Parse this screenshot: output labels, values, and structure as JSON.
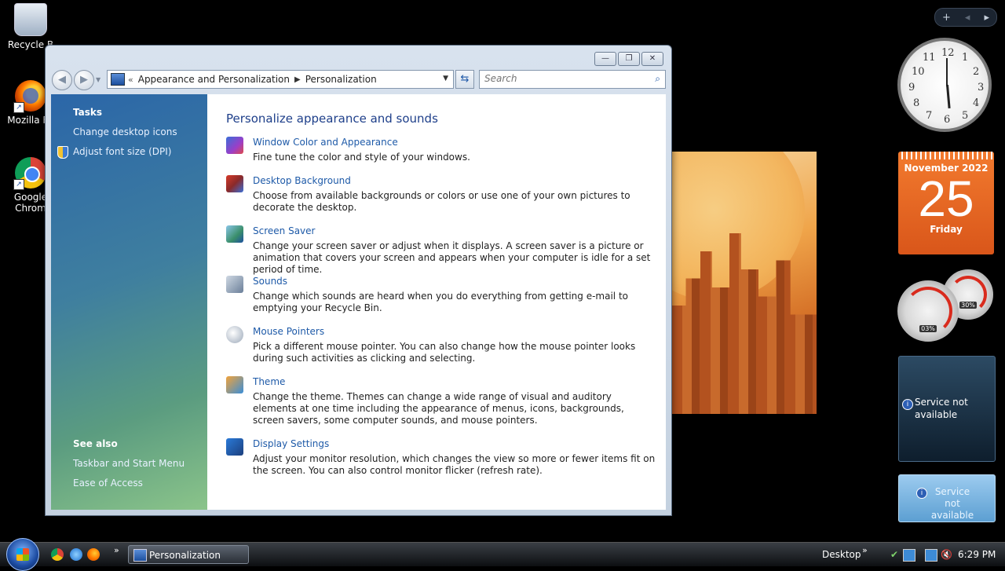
{
  "desktop_icons": [
    {
      "label": "Recycle B",
      "icon": "recycle-bin-icon"
    },
    {
      "label": "Mozilla Fir",
      "icon": "firefox-icon"
    },
    {
      "label": "Google Chrom",
      "icon": "chrome-icon"
    }
  ],
  "window": {
    "address": {
      "crumb1": "Appearance and Personalization",
      "crumb2": "Personalization"
    },
    "search_placeholder": "Search",
    "sidebar": {
      "tasks_heading": "Tasks",
      "tasks": [
        "Change desktop icons",
        "Adjust font size (DPI)"
      ],
      "see_also_heading": "See also",
      "see_also": [
        "Taskbar and Start Menu",
        "Ease of Access"
      ]
    },
    "title": "Personalize appearance and sounds",
    "items": [
      {
        "link": "Window Color and Appearance",
        "desc": "Fine tune the color and style of your windows.",
        "icon": "window-color-icon"
      },
      {
        "link": "Desktop Background",
        "desc": "Choose from available backgrounds or colors or use one of your own pictures to decorate the desktop.",
        "icon": "desktop-background-icon"
      },
      {
        "link": "Screen Saver",
        "desc": "Change your screen saver or adjust when it displays. A screen saver is a picture or animation that covers your screen and appears when your computer is idle for a set period of time.",
        "icon": "screen-saver-icon"
      },
      {
        "link": "Sounds",
        "desc": "Change which sounds are heard when you do everything from getting e-mail to emptying your Recycle Bin.",
        "icon": "sounds-icon"
      },
      {
        "link": "Mouse Pointers",
        "desc": "Pick a different mouse pointer. You can also change how the mouse pointer looks during such activities as clicking and selecting.",
        "icon": "mouse-pointer-icon"
      },
      {
        "link": "Theme",
        "desc": "Change the theme. Themes can change a wide range of visual and auditory elements at one time including the appearance of menus, icons, backgrounds, screen savers, some computer sounds, and mouse pointers.",
        "icon": "theme-icon"
      },
      {
        "link": "Display Settings",
        "desc": "Adjust your monitor resolution, which changes the view so more or fewer items fit on the screen. You can also control monitor flicker (refresh rate).",
        "icon": "display-settings-icon"
      }
    ]
  },
  "gadgets": {
    "clock_numbers": [
      "12",
      "1",
      "2",
      "3",
      "4",
      "5",
      "6",
      "7",
      "8",
      "9",
      "10",
      "11"
    ],
    "calendar": {
      "month": "November 2022",
      "day": "25",
      "weekday": "Friday"
    },
    "cpu_meter": {
      "cpu_label": "03%",
      "memory_label": "30%"
    },
    "weather1": "Service not available",
    "weather2": "Service not available"
  },
  "taskbar": {
    "task_label": "Personalization",
    "desktop_label": "Desktop",
    "time": "6:29 PM"
  }
}
